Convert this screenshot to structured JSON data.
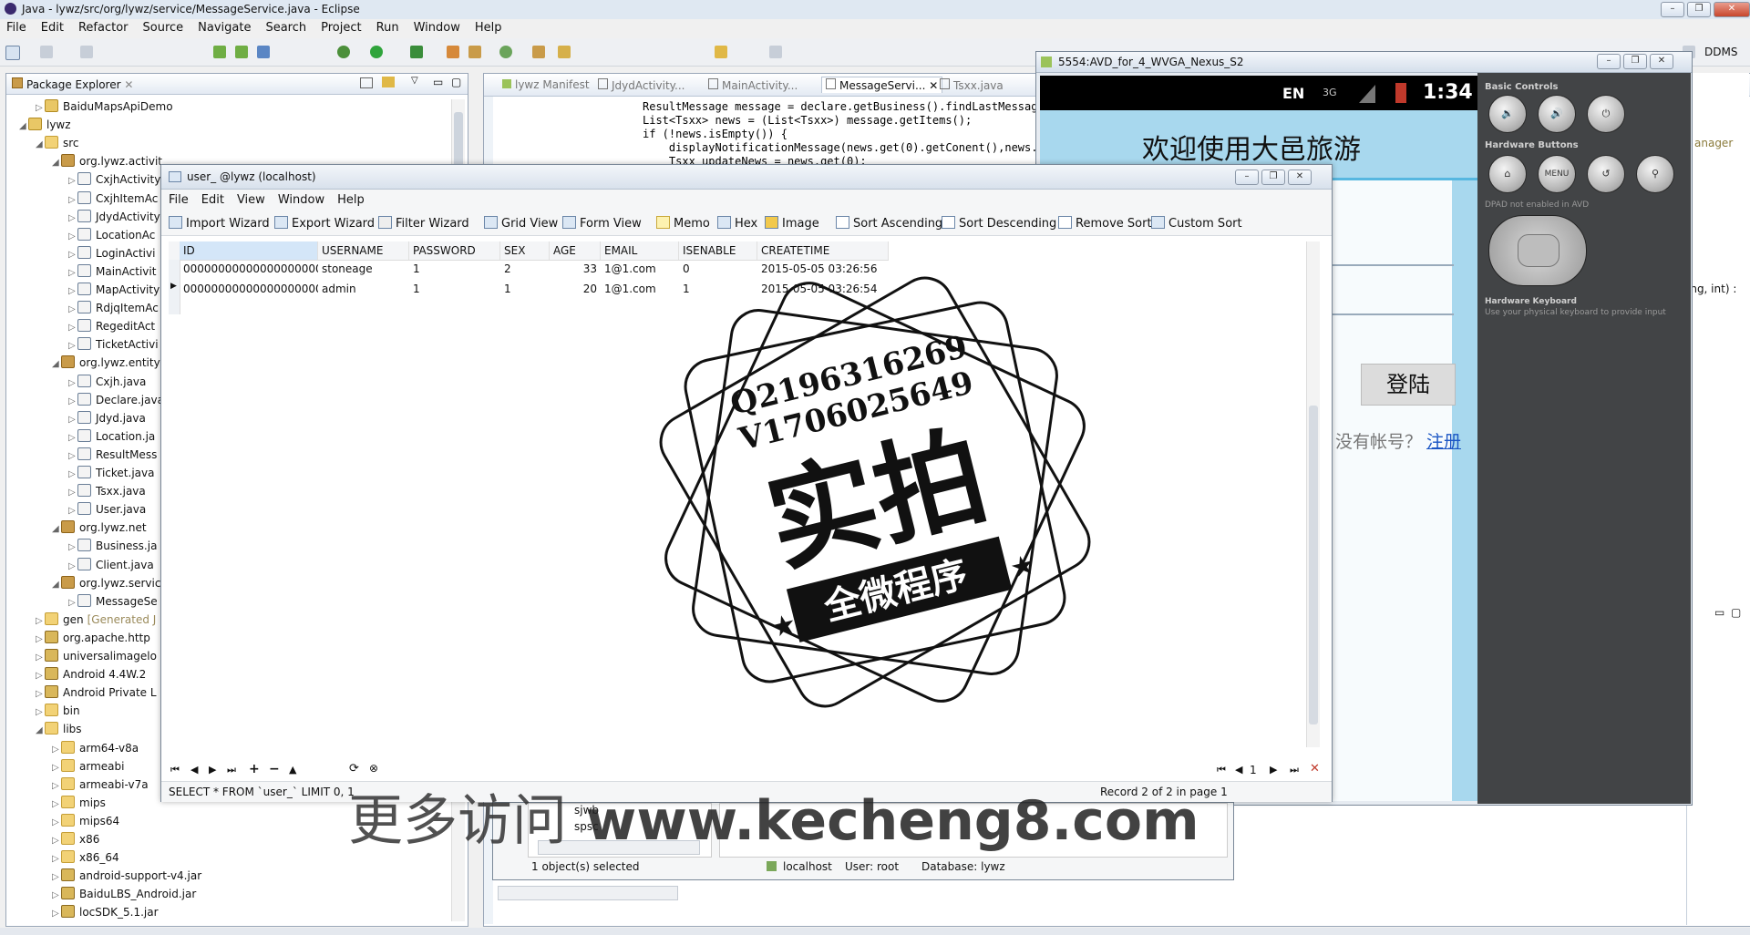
{
  "eclipse": {
    "title": "Java - lywz/src/org/lywz/service/MessageService.java - Eclipse",
    "menu": [
      "File",
      "Edit",
      "Refactor",
      "Source",
      "Navigate",
      "Search",
      "Project",
      "Run",
      "Window",
      "Help"
    ],
    "perspective": "DDMS"
  },
  "package_explorer": {
    "tab_label": "Package Explorer",
    "tree": [
      {
        "label": "BaiduMapsApiDemo",
        "indent": 1,
        "icon": "project"
      },
      {
        "label": "lywz",
        "indent": 0,
        "icon": "project",
        "open": true
      },
      {
        "label": "src",
        "indent": 1,
        "icon": "folder",
        "open": true
      },
      {
        "label": "org.lywz.activit",
        "indent": 2,
        "icon": "package",
        "open": true
      },
      {
        "label": "CxjhActivity",
        "indent": 3,
        "icon": "java"
      },
      {
        "label": "CxjhItemAc",
        "indent": 3,
        "icon": "java"
      },
      {
        "label": "JdydActivity",
        "indent": 3,
        "icon": "java"
      },
      {
        "label": "LocationAc",
        "indent": 3,
        "icon": "java"
      },
      {
        "label": "LoginActivi",
        "indent": 3,
        "icon": "java"
      },
      {
        "label": "MainActivit",
        "indent": 3,
        "icon": "java"
      },
      {
        "label": "MapActivity",
        "indent": 3,
        "icon": "java"
      },
      {
        "label": "RdjqItemAc",
        "indent": 3,
        "icon": "java"
      },
      {
        "label": "RegeditAct",
        "indent": 3,
        "icon": "java"
      },
      {
        "label": "TicketActivi",
        "indent": 3,
        "icon": "java"
      },
      {
        "label": "org.lywz.entity",
        "indent": 2,
        "icon": "package",
        "open": true
      },
      {
        "label": "Cxjh.java",
        "indent": 3,
        "icon": "java"
      },
      {
        "label": "Declare.java",
        "indent": 3,
        "icon": "java"
      },
      {
        "label": "Jdyd.java",
        "indent": 3,
        "icon": "java"
      },
      {
        "label": "Location.ja",
        "indent": 3,
        "icon": "java"
      },
      {
        "label": "ResultMess",
        "indent": 3,
        "icon": "java"
      },
      {
        "label": "Ticket.java",
        "indent": 3,
        "icon": "java"
      },
      {
        "label": "Tsxx.java",
        "indent": 3,
        "icon": "java"
      },
      {
        "label": "User.java",
        "indent": 3,
        "icon": "java"
      },
      {
        "label": "org.lywz.net",
        "indent": 2,
        "icon": "package",
        "open": true
      },
      {
        "label": "Business.ja",
        "indent": 3,
        "icon": "java"
      },
      {
        "label": "Client.java",
        "indent": 3,
        "icon": "java"
      },
      {
        "label": "org.lywz.servic",
        "indent": 2,
        "icon": "package",
        "open": true
      },
      {
        "label": "MessageSe",
        "indent": 3,
        "icon": "java"
      },
      {
        "label": "gen",
        "suffix": "[Generated J",
        "indent": 1,
        "icon": "folder"
      },
      {
        "label": "org.apache.http",
        "indent": 1,
        "icon": "lib"
      },
      {
        "label": "universalimagelo",
        "indent": 1,
        "icon": "lib"
      },
      {
        "label": "Android 4.4W.2",
        "indent": 1,
        "icon": "lib"
      },
      {
        "label": "Android Private L",
        "indent": 1,
        "icon": "lib"
      },
      {
        "label": "bin",
        "indent": 1,
        "icon": "folder"
      },
      {
        "label": "libs",
        "indent": 1,
        "icon": "folder",
        "open": true
      },
      {
        "label": "arm64-v8a",
        "indent": 2,
        "icon": "folder"
      },
      {
        "label": "armeabi",
        "indent": 2,
        "icon": "folder"
      },
      {
        "label": "armeabi-v7a",
        "indent": 2,
        "icon": "folder"
      },
      {
        "label": "mips",
        "indent": 2,
        "icon": "folder"
      },
      {
        "label": "mips64",
        "indent": 2,
        "icon": "folder"
      },
      {
        "label": "x86",
        "indent": 2,
        "icon": "folder"
      },
      {
        "label": "x86_64",
        "indent": 2,
        "icon": "folder"
      },
      {
        "label": "android-support-v4.jar",
        "indent": 2,
        "icon": "lib"
      },
      {
        "label": "BaiduLBS_Android.jar",
        "indent": 2,
        "icon": "lib"
      },
      {
        "label": "locSDK_5.1.jar",
        "indent": 2,
        "icon": "lib"
      }
    ]
  },
  "editor": {
    "tabs": [
      "lywz Manifest",
      "JdydActivity...",
      "MainActivity...",
      "MessageServi...",
      "Tsxx.java"
    ],
    "active_tab": 3,
    "code_lines": [
      "ResultMessage message = declare.getBusiness().findLastMessage(",
      "List<Tsxx> news = (List<Tsxx>) message.getItems();",
      "if (!news.isEmpty()) {",
      "    displayNotificationMessage(news.get(0).getConent(),news.ge",
      "    Tsxx updateNews = news.get(0);"
    ],
    "right_fragments": [
      "anager",
      "ing, int) :"
    ]
  },
  "emulator": {
    "title": "5554:AVD_for_4_WVGA_Nexus_S2",
    "status_lang": "EN",
    "status_net": "3G",
    "clock": "1:34",
    "app_title": "欢迎使用大邑旅游",
    "login_button": "登陆",
    "no_account_text": "没有帐号？",
    "register_link": "注册",
    "side": {
      "basic_controls": "Basic Controls",
      "hardware_buttons": "Hardware Buttons",
      "menu_label": "MENU",
      "dpad_note": "DPAD not enabled in AVD",
      "keyboard_title": "Hardware Keyboard",
      "keyboard_note": "Use your physical keyboard to provide input"
    }
  },
  "navicat": {
    "title": "user_ @lywz (localhost)",
    "menu": [
      "File",
      "Edit",
      "View",
      "Window",
      "Help"
    ],
    "toolbar": [
      "Import Wizard",
      "Export Wizard",
      "Filter Wizard",
      "Grid View",
      "Form View",
      "Memo",
      "Hex",
      "Image",
      "Sort Ascending",
      "Sort Descending",
      "Remove Sort",
      "Custom Sort"
    ],
    "columns": [
      "ID",
      "USERNAME",
      "PASSWORD",
      "SEX",
      "AGE",
      "EMAIL",
      "ISENABLE",
      "CREATETIME"
    ],
    "rows": [
      [
        "00000000000000000000",
        "stoneage",
        "1",
        "2",
        "33",
        "1@1.com",
        "0",
        "2015-05-05 03:26:56"
      ],
      [
        "00000000000000000000",
        "admin",
        "1",
        "1",
        "20",
        "1@1.com",
        "1",
        "2015-05-05 03:26:54"
      ]
    ],
    "page_number": "1",
    "sql": "SELECT * FROM `user_` LIMIT 0, 1",
    "record_status": "Record 2 of 2 in page 1"
  },
  "navicat_main": {
    "tree_items": [
      "sjwb",
      "spsc"
    ],
    "selected": "1 object(s) selected",
    "conn_host": "localhost",
    "conn_user": "User: root",
    "conn_db": "Database: lywz"
  },
  "watermark": {
    "q": "Q2196316269",
    "v": "V1706025649",
    "big": "实拍",
    "banner": "全微程序",
    "bottom_cn": "更多访问",
    "bottom_url": "www.kecheng8.com"
  }
}
